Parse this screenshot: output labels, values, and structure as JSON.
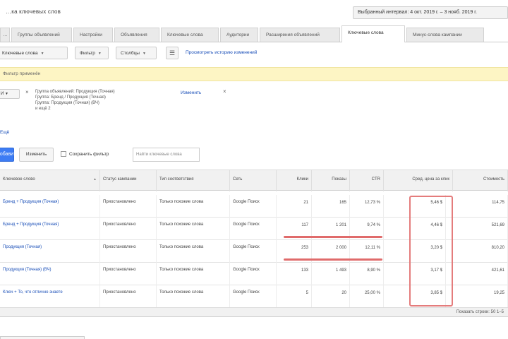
{
  "header": {
    "title": "…ка ключевых слов",
    "date_range": "Выбранный интервал: 4 окт. 2019 г. – 3 нояб. 2019 г."
  },
  "tabs": [
    {
      "label": "…"
    },
    {
      "label": "Группы объявлений"
    },
    {
      "label": "Настройки"
    },
    {
      "label": "Объявления"
    },
    {
      "label": "Ключевые слова"
    },
    {
      "label": "Аудитории"
    },
    {
      "label": "Расширения объявлений"
    },
    {
      "label": "Ключевые слова",
      "active": true
    },
    {
      "label": "Минус-слова кампании"
    }
  ],
  "toolbar": {
    "dropdown_1": "Ключевые слова",
    "dropdown_2": "Фильтр",
    "dropdown_3": "Столбцы",
    "link": "Просмотреть историю изменений"
  },
  "notice": {
    "text": "Фильтр применён"
  },
  "filters": {
    "dropdown": "И",
    "lines": [
      "Группа объявлений: Продукция (Точная)",
      "Группа: Бренд / Продукция (Точная)",
      "Группа: Продукция (Точная) (ВЧ)",
      "и ещё 2"
    ],
    "edit_link": "Изменить",
    "more_link": "Ещё"
  },
  "actions": {
    "primary_button": "Добавить",
    "secondary_button": "Изменить",
    "checkbox_label": "Сохранить фильтр",
    "search_placeholder": "Найти ключевые слова"
  },
  "table": {
    "columns": [
      {
        "label": "Ключевое слово"
      },
      {
        "label": "Статус кампании"
      },
      {
        "label": "Тип соответствия"
      },
      {
        "label": "Сеть"
      },
      {
        "label": "Клики"
      },
      {
        "label": "Показы"
      },
      {
        "label": "CTR"
      },
      {
        "label": "Сред. цена за клик"
      },
      {
        "label": "Стоимость"
      }
    ],
    "rows": [
      {
        "keyword": "Бренд + Продукция (Точная)",
        "status": "Приостановлено",
        "match": "Только похожие слова",
        "network": "Google Поиск",
        "clicks": "21",
        "impr": "165",
        "ctr": "12,73 %",
        "cpc": "5,46 $",
        "cost": "114,75"
      },
      {
        "keyword": "Бренд + Продукция (Точная)",
        "status": "Приостановлено",
        "match": "Только похожие слова",
        "network": "Google Поиск",
        "clicks": "117",
        "impr": "1 201",
        "ctr": "9,74 %",
        "cpc": "4,46 $",
        "cost": "521,69"
      },
      {
        "keyword": "Продукция (Точная)",
        "status": "Приостановлено",
        "match": "Только похожие слова",
        "network": "Google Поиск",
        "clicks": "253",
        "impr": "2 000",
        "ctr": "12,11 %",
        "cpc": "3,20 $",
        "cost": "810,20"
      },
      {
        "keyword": "Продукция (Точная) (ВЧ)",
        "status": "Приостановлено",
        "match": "Только похожие слова",
        "network": "Google Поиск",
        "clicks": "133",
        "impr": "1 493",
        "ctr": "8,90 %",
        "cpc": "3,17 $",
        "cost": "421,61"
      },
      {
        "keyword": "Ключ + То, что отлично знаете",
        "status": "Приостановлено",
        "match": "Только похожие слова",
        "network": "Google Поиск",
        "clicks": "5",
        "impr": "20",
        "ctr": "25,00 %",
        "cpc": "3,85 $",
        "cost": "19,25"
      }
    ],
    "pager": "Показать строки: 50 1–5"
  },
  "colors": {
    "accent": "#3d7cf4",
    "link": "#1a4fb8",
    "notice_bg": "#fdf5c4",
    "highlight": "#e06b6b"
  }
}
